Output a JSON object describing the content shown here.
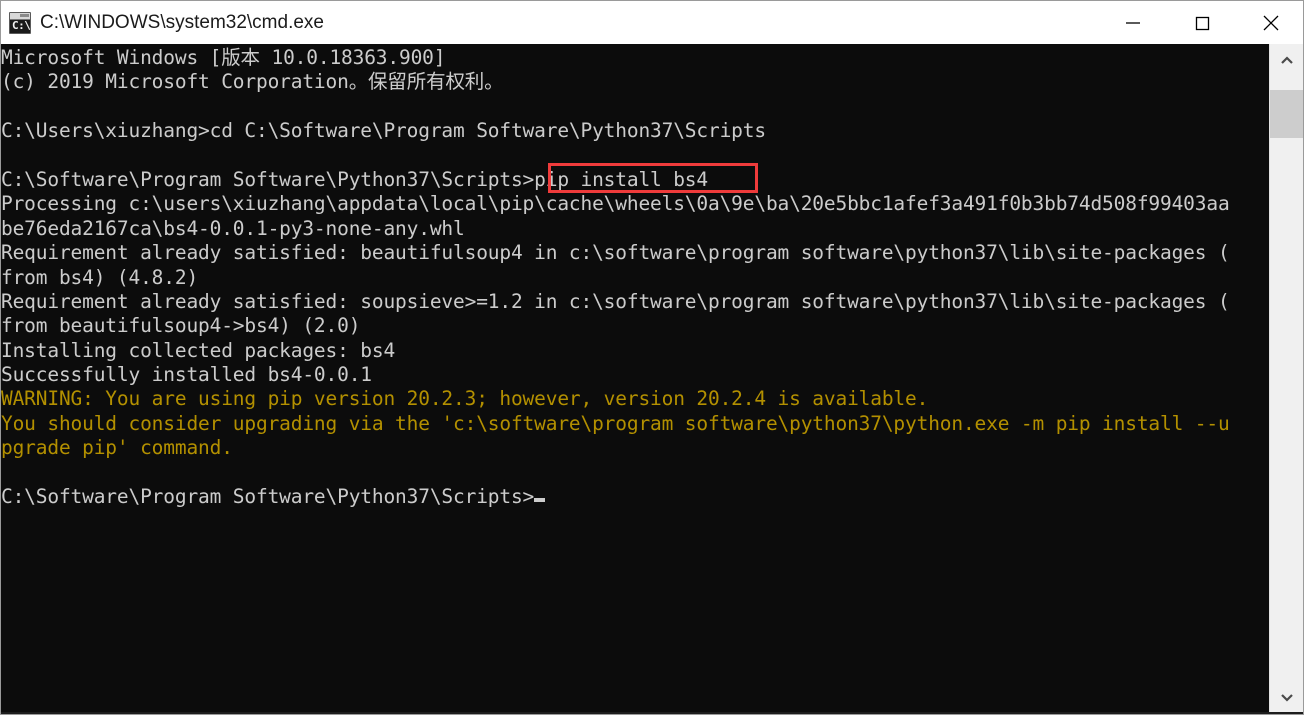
{
  "window": {
    "title": "C:\\WINDOWS\\system32\\cmd.exe",
    "icon_name": "cmd-console-icon",
    "icon_glyph": "C:\\",
    "background_color": "#0c0c0c",
    "titlebar_color": "#ffffff",
    "text_color": "#cccccc",
    "warning_color": "#b39000",
    "annotation_color": "#ef3b3b"
  },
  "controls": {
    "minimize_label": "Minimize",
    "maximize_label": "Maximize",
    "close_label": "Close"
  },
  "scrollbar": {
    "up_arrow_label": "Scroll up",
    "down_arrow_label": "Scroll down",
    "thumb_label": "Vertical scroll thumb"
  },
  "console": {
    "lines": [
      {
        "text": "Microsoft Windows [版本 10.0.18363.900]",
        "style": "normal"
      },
      {
        "text": "(c) 2019 Microsoft Corporation。保留所有权利。",
        "style": "normal"
      },
      {
        "text": "",
        "style": "normal"
      },
      {
        "text": "C:\\Users\\xiuzhang>cd C:\\Software\\Program Software\\Python37\\Scripts",
        "style": "normal"
      },
      {
        "text": "",
        "style": "normal"
      },
      {
        "text": "C:\\Software\\Program Software\\Python37\\Scripts>pip install bs4",
        "style": "normal"
      },
      {
        "text": "Processing c:\\users\\xiuzhang\\appdata\\local\\pip\\cache\\wheels\\0a\\9e\\ba\\20e5bbc1afef3a491f0b3bb74d508f99403aa",
        "style": "normal"
      },
      {
        "text": "be76eda2167ca\\bs4-0.0.1-py3-none-any.whl",
        "style": "normal"
      },
      {
        "text": "Requirement already satisfied: beautifulsoup4 in c:\\software\\program software\\python37\\lib\\site-packages (",
        "style": "normal"
      },
      {
        "text": "from bs4) (4.8.2)",
        "style": "normal"
      },
      {
        "text": "Requirement already satisfied: soupsieve>=1.2 in c:\\software\\program software\\python37\\lib\\site-packages (",
        "style": "normal"
      },
      {
        "text": "from beautifulsoup4->bs4) (2.0)",
        "style": "normal"
      },
      {
        "text": "Installing collected packages: bs4",
        "style": "normal"
      },
      {
        "text": "Successfully installed bs4-0.0.1",
        "style": "normal"
      },
      {
        "text": "WARNING: You are using pip version 20.2.3; however, version 20.2.4 is available.",
        "style": "warning"
      },
      {
        "text": "You should consider upgrading via the 'c:\\software\\program software\\python37\\python.exe -m pip install --u",
        "style": "warning"
      },
      {
        "text": "pgrade pip' command.",
        "style": "warning"
      },
      {
        "text": "",
        "style": "normal"
      },
      {
        "text": "C:\\Software\\Program Software\\Python37\\Scripts>",
        "style": "prompt"
      }
    ],
    "highlighted_command": "pip install bs4",
    "current_prompt": "C:\\Software\\Program Software\\Python37\\Scripts>"
  }
}
